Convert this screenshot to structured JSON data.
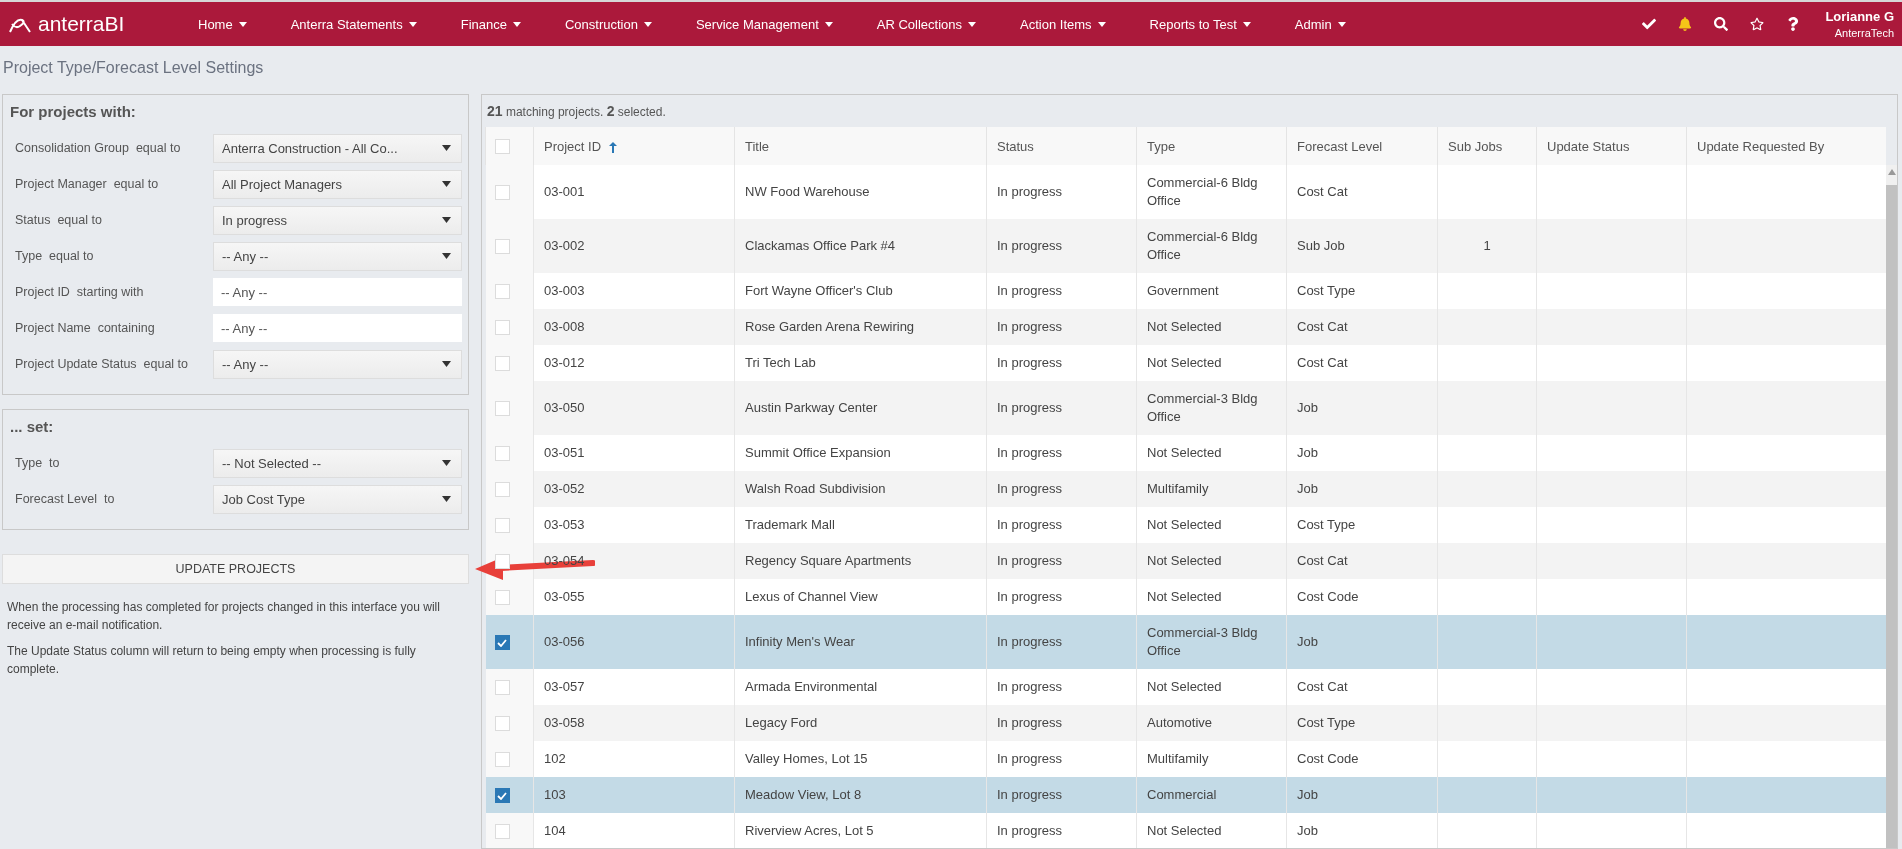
{
  "navbar": {
    "logo": "anterraBI",
    "menus": [
      "Home",
      "Anterra Statements",
      "Finance",
      "Construction",
      "Service Management",
      "AR Collections",
      "Action Items",
      "Reports to Test",
      "Admin"
    ],
    "user": {
      "name": "Lorianne G",
      "company": "AnterraTech"
    }
  },
  "page_title": "Project Type/Forecast Level Settings",
  "filters": {
    "heading": "For projects with:",
    "rows": [
      {
        "kind": "select",
        "label": "Consolidation Group  equal to",
        "value": "Anterra Construction - All Co..."
      },
      {
        "kind": "select",
        "label": "Project Manager  equal to",
        "value": "All Project Managers"
      },
      {
        "kind": "select",
        "label": "Status  equal to",
        "value": "In progress"
      },
      {
        "kind": "select",
        "label": "Type  equal to",
        "value": "-- Any --"
      },
      {
        "kind": "text",
        "label": "Project ID  starting with",
        "placeholder": "-- Any --"
      },
      {
        "kind": "text",
        "label": "Project Name  containing",
        "placeholder": "-- Any --"
      },
      {
        "kind": "select",
        "label": "Project Update Status  equal to",
        "value": "-- Any --"
      }
    ]
  },
  "set": {
    "heading": "... set:",
    "rows": [
      {
        "kind": "select",
        "label": "Type  to",
        "value": "-- Not Selected --"
      },
      {
        "kind": "select",
        "label": "Forecast Level  to",
        "value": "Job Cost Type"
      }
    ]
  },
  "update_button": "UPDATE PROJECTS",
  "notes": [
    "When the processing has completed for projects changed in this interface you will receive an e-mail notification.",
    "The Update Status column will return to being empty when processing is fully complete."
  ],
  "table": {
    "summary": "**21** matching projects. **2** selected.",
    "select_all": {
      "checked": false
    },
    "columns": [
      {
        "label": "Project ID",
        "sorted": true
      },
      {
        "label": "Title",
        "sorted": false
      },
      {
        "label": "Status",
        "sorted": false
      },
      {
        "label": "Type",
        "sorted": false
      },
      {
        "label": "Forecast Level",
        "sorted": false
      },
      {
        "label": "Sub Jobs",
        "sorted": false
      },
      {
        "label": "Update Status",
        "sorted": false
      },
      {
        "label": "Update Requested By",
        "sorted": false
      }
    ],
    "rows": [
      {
        "selected": false,
        "cells": [
          "03-001",
          "NW Food Warehouse",
          "In progress",
          "Commercial-6 Bldg Office",
          "Cost Cat",
          "",
          "",
          ""
        ]
      },
      {
        "selected": false,
        "cells": [
          "03-002",
          "Clackamas Office Park #4",
          "In progress",
          "Commercial-6 Bldg Office",
          "Sub Job",
          "1",
          "",
          ""
        ]
      },
      {
        "selected": false,
        "cells": [
          "03-003",
          "Fort Wayne Officer's Club",
          "In progress",
          "Government",
          "Cost Type",
          "",
          "",
          ""
        ]
      },
      {
        "selected": false,
        "cells": [
          "03-008",
          "Rose Garden Arena Rewiring",
          "In progress",
          "Not Selected",
          "Cost Cat",
          "",
          "",
          ""
        ]
      },
      {
        "selected": false,
        "cells": [
          "03-012",
          "Tri Tech Lab",
          "In progress",
          "Not Selected",
          "Cost Cat",
          "",
          "",
          ""
        ]
      },
      {
        "selected": false,
        "cells": [
          "03-050",
          "Austin Parkway Center",
          "In progress",
          "Commercial-3 Bldg Office",
          "Job",
          "",
          "",
          ""
        ]
      },
      {
        "selected": false,
        "cells": [
          "03-051",
          "Summit Office Expansion",
          "In progress",
          "Not Selected",
          "Job",
          "",
          "",
          ""
        ]
      },
      {
        "selected": false,
        "cells": [
          "03-052",
          "Walsh Road Subdivision",
          "In progress",
          "Multifamily",
          "Job",
          "",
          "",
          ""
        ]
      },
      {
        "selected": false,
        "cells": [
          "03-053",
          "Trademark Mall",
          "In progress",
          "Not Selected",
          "Cost Type",
          "",
          "",
          ""
        ]
      },
      {
        "selected": false,
        "cells": [
          "03-054",
          "Regency Square Apartments",
          "In progress",
          "Not Selected",
          "Cost Cat",
          "",
          "",
          ""
        ]
      },
      {
        "selected": false,
        "cells": [
          "03-055",
          "Lexus of Channel View",
          "In progress",
          "Not Selected",
          "Cost Code",
          "",
          "",
          ""
        ]
      },
      {
        "selected": true,
        "cells": [
          "03-056",
          "Infinity Men's Wear",
          "In progress",
          "Commercial-3 Bldg Office",
          "Job",
          "",
          "",
          ""
        ]
      },
      {
        "selected": false,
        "cells": [
          "03-057",
          "Armada Environmental",
          "In progress",
          "Not Selected",
          "Cost Cat",
          "",
          "",
          ""
        ]
      },
      {
        "selected": false,
        "cells": [
          "03-058",
          "Legacy Ford",
          "In progress",
          "Automotive",
          "Cost Type",
          "",
          "",
          ""
        ]
      },
      {
        "selected": false,
        "cells": [
          "102",
          "Valley Homes, Lot 15",
          "In progress",
          "Multifamily",
          "Cost Code",
          "",
          "",
          ""
        ]
      },
      {
        "selected": true,
        "cells": [
          "103",
          "Meadow View, Lot 8",
          "In progress",
          "Commercial",
          "Job",
          "",
          "",
          ""
        ]
      },
      {
        "selected": false,
        "cells": [
          "104",
          "Riverview Acres, Lot 5",
          "In progress",
          "Not Selected",
          "Job",
          "",
          "",
          ""
        ]
      }
    ]
  }
}
